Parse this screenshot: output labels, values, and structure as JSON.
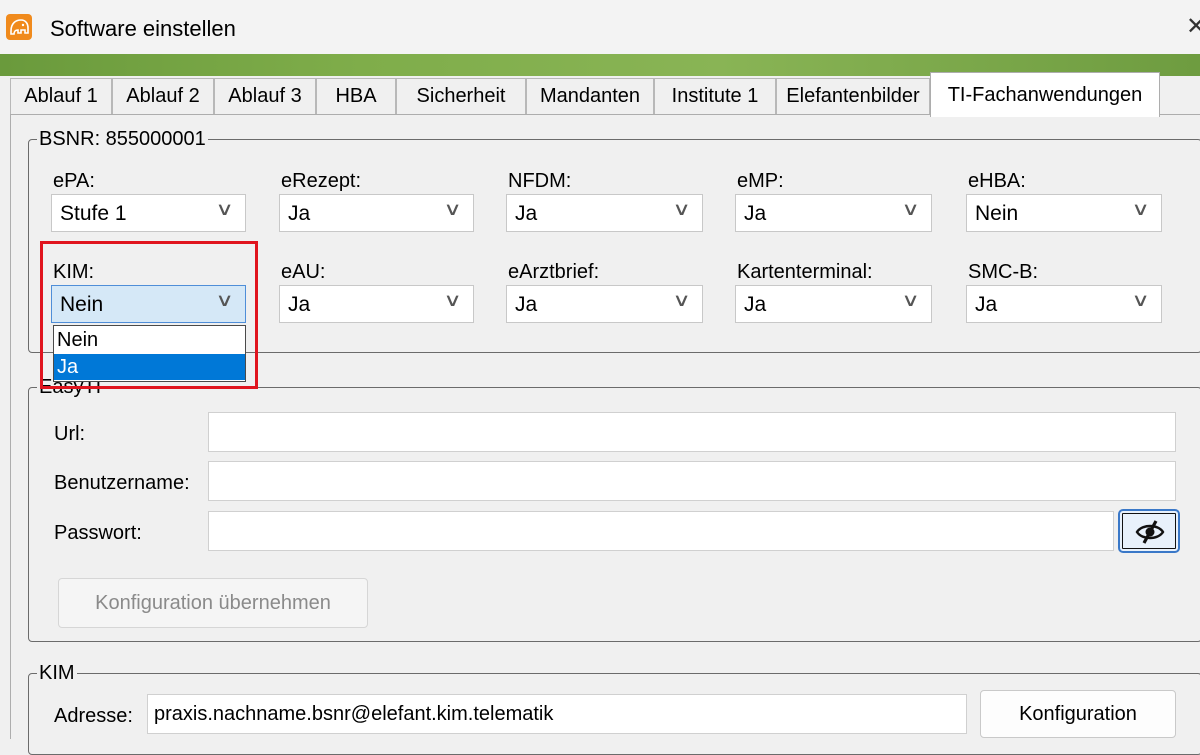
{
  "window": {
    "title": "Software einstellen",
    "close_glyph": "✕"
  },
  "tabs": [
    {
      "label": "Ablauf 1"
    },
    {
      "label": "Ablauf 2"
    },
    {
      "label": "Ablauf 3"
    },
    {
      "label": "HBA"
    },
    {
      "label": "Sicherheit"
    },
    {
      "label": "Mandanten"
    },
    {
      "label": "Institute 1"
    },
    {
      "label": "Elefantenbilder"
    },
    {
      "label": "TI-Fachanwendungen",
      "active": true
    }
  ],
  "bsnr_group": {
    "legend": "BSNR: 855000001",
    "fields": [
      {
        "label": "ePA:",
        "value": "Stufe 1"
      },
      {
        "label": "eRezept:",
        "value": "Ja"
      },
      {
        "label": "NFDM:",
        "value": "Ja"
      },
      {
        "label": "eMP:",
        "value": "Ja"
      },
      {
        "label": "eHBA:",
        "value": "Nein"
      },
      {
        "label": "KIM:",
        "value": "Nein",
        "open": true
      },
      {
        "label": "eAU:",
        "value": "Ja"
      },
      {
        "label": "eArztbrief:",
        "value": "Ja"
      },
      {
        "label": "Kartenterminal:",
        "value": "Ja"
      },
      {
        "label": "SMC-B:",
        "value": "Ja"
      }
    ],
    "kim_dropdown": {
      "options": [
        "Nein",
        "Ja"
      ],
      "highlighted": "Ja"
    }
  },
  "easyti_group": {
    "legend": "EasyTI",
    "url_label": "Url:",
    "url_value": "",
    "user_label": "Benutzername:",
    "user_value": "",
    "password_label": "Passwort:",
    "password_value": "",
    "toggle_icon": "eye-slash-icon",
    "apply_button": "Konfiguration übernehmen"
  },
  "kim_group": {
    "legend": "KIM",
    "address_label": "Adresse:",
    "address_value": "praxis.nachname.bsnr@elefant.kim.telematik",
    "config_button": "Konfiguration"
  },
  "colors": {
    "highlight_border": "#e0141e",
    "selection": "#0078d7",
    "title_strip": "#7fad4a",
    "app_icon": "#f08a1c"
  }
}
